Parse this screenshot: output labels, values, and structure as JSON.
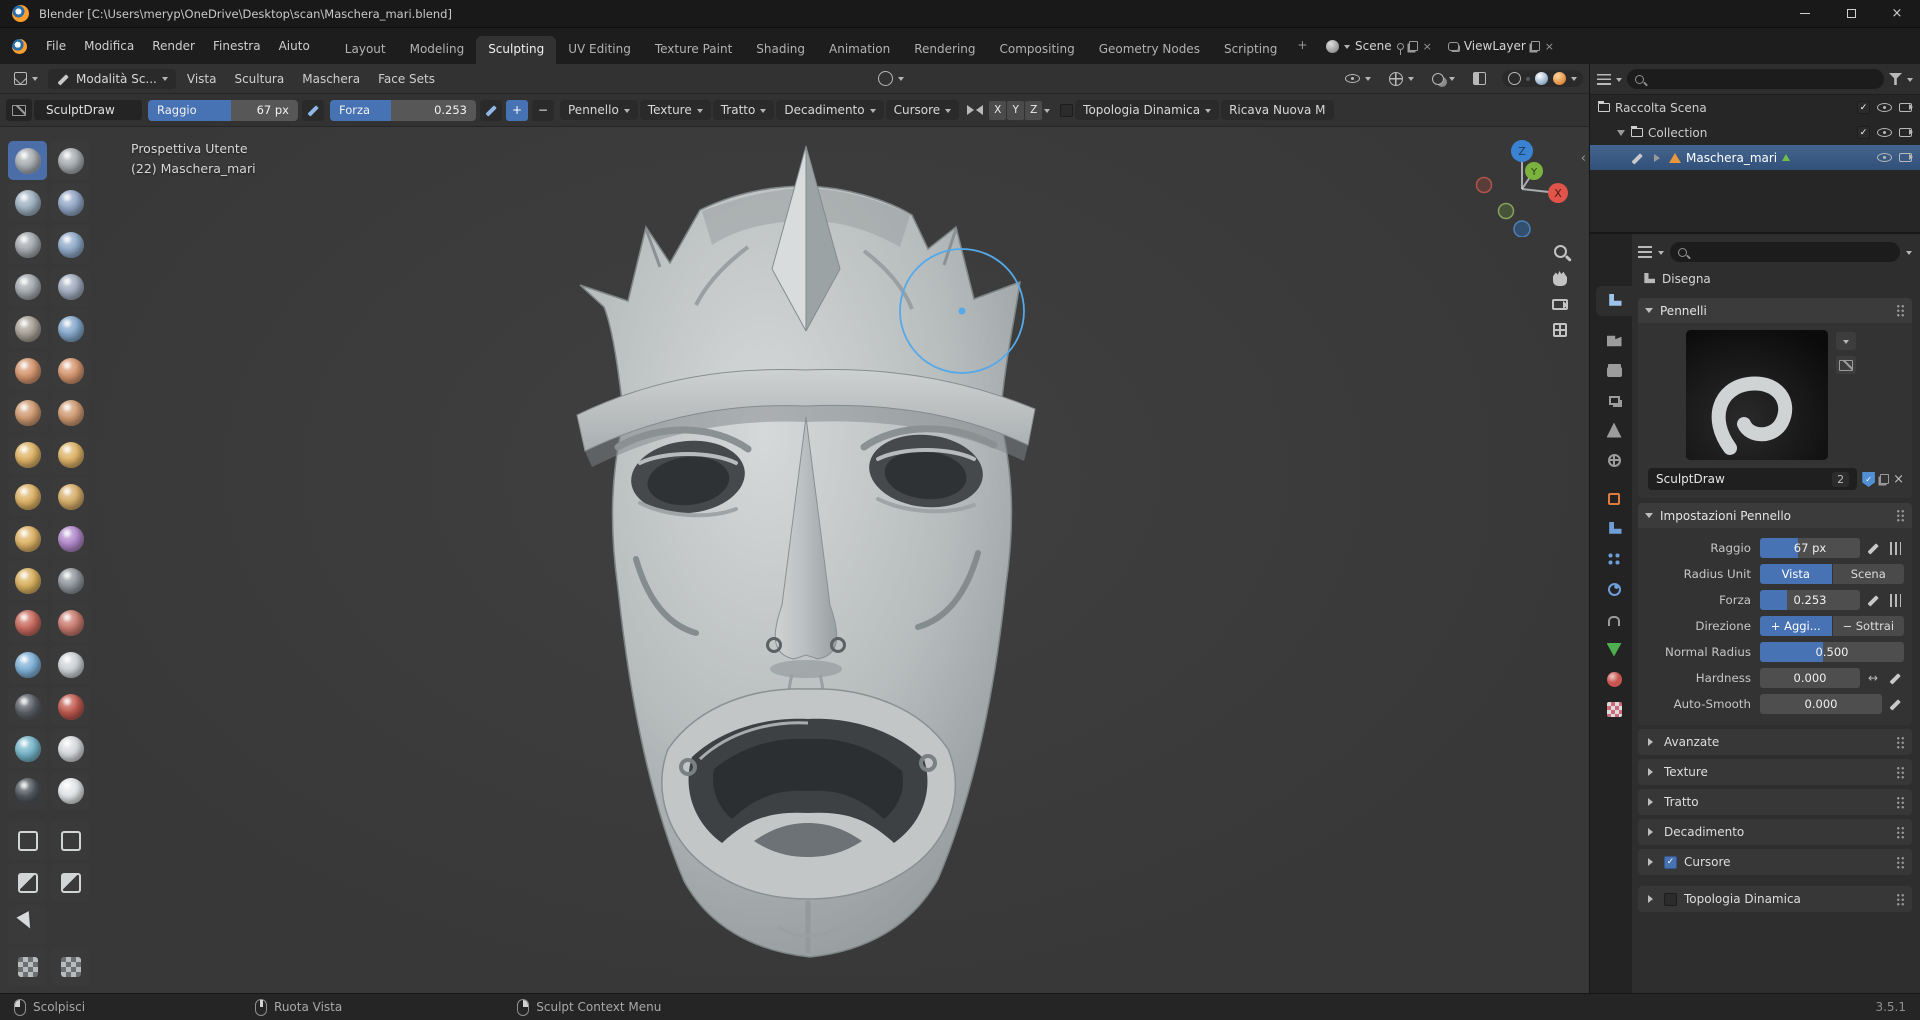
{
  "colors": {
    "accent": "#4772b3",
    "axis_x": "#e0544a",
    "axis_y": "#7cb33e",
    "axis_z": "#3a83d2",
    "cursor": "#54a9ea"
  },
  "icons": {
    "close": "×",
    "check": "✓",
    "arrows": "↔",
    "collapse": "‹"
  },
  "window": {
    "title": "Blender [C:\\Users\\meryp\\OneDrive\\Desktop\\scan\\Maschera_mari.blend]"
  },
  "menubar": {
    "menus": [
      "File",
      "Modifica",
      "Render",
      "Finestra",
      "Aiuto"
    ],
    "workspaces": [
      "Layout",
      "Modeling",
      "Sculpting",
      "UV Editing",
      "Texture Paint",
      "Shading",
      "Animation",
      "Rendering",
      "Compositing",
      "Geometry Nodes",
      "Scripting"
    ],
    "active_workspace": "Sculpting",
    "add_tab": "+",
    "scene_label": "Scene",
    "viewlayer_label": "ViewLayer"
  },
  "viewheader": {
    "mode_label": "Modalità Sc...",
    "menus": [
      "Vista",
      "Scultura",
      "Maschera",
      "Face Sets"
    ]
  },
  "brushheader": {
    "brush_label": "SculptDraw",
    "radius_label": "Raggio",
    "radius_value": "67 px",
    "radius_fill": 0.55,
    "strength_label": "Forza",
    "strength_value": "0.253",
    "strength_fill": 0.42,
    "add_label": "+",
    "subtract_label": "−",
    "dropdowns": [
      "Pennello",
      "Texture",
      "Tratto",
      "Decadimento",
      "Cursore"
    ],
    "axes": [
      "X",
      "Y",
      "Z"
    ],
    "dyntopo_label": "Topologia Dinamica",
    "remesh_label": "Ricava Nuova M"
  },
  "viewport": {
    "view_label": "Prospettiva Utente",
    "object_label": "(22) Maschera_mari",
    "gizmo": {
      "x": "X",
      "y": "Y",
      "z": "Z"
    }
  },
  "toolbar": {
    "selected": "draw",
    "brushes": [
      {
        "name": "draw",
        "color": "#a9aeb3"
      },
      {
        "name": "draw-sharp",
        "color": "#a9aeb3"
      },
      {
        "name": "clay",
        "color": "#9eb1c0"
      },
      {
        "name": "clay-strips",
        "color": "#92a7c5"
      },
      {
        "name": "clay-thumb",
        "color": "#a5aaaf"
      },
      {
        "name": "layer",
        "color": "#90aac9"
      },
      {
        "name": "inflate",
        "color": "#a5aaaf"
      },
      {
        "name": "blob",
        "color": "#a0acbe"
      },
      {
        "name": "crease",
        "color": "#a8a298"
      },
      {
        "name": "smooth",
        "color": "#85a8cc"
      },
      {
        "name": "flatten",
        "color": "#d5966f"
      },
      {
        "name": "fill",
        "color": "#d5966f"
      },
      {
        "name": "scrape",
        "color": "#d09b73"
      },
      {
        "name": "multiplane-scrape",
        "color": "#d09b73"
      },
      {
        "name": "pinch",
        "color": "#deb367"
      },
      {
        "name": "grab",
        "color": "#deb367"
      },
      {
        "name": "elastic-deform",
        "color": "#deb367"
      },
      {
        "name": "snake-hook",
        "color": "#d6ae69"
      },
      {
        "name": "thumb",
        "color": "#deb367"
      },
      {
        "name": "pose",
        "color": "#b188ca"
      },
      {
        "name": "nudge",
        "color": "#d9b15f"
      },
      {
        "name": "rotate",
        "color": "#90979d"
      },
      {
        "name": "slide-relax",
        "color": "#c96b5f"
      },
      {
        "name": "boundary",
        "color": "#c97b6f"
      },
      {
        "name": "cloth",
        "color": "#80b1d7"
      },
      {
        "name": "simplify",
        "color": "#ced3d7"
      },
      {
        "name": "mask",
        "color": "#5c6167"
      },
      {
        "name": "draw-face-sets",
        "color": "#c05a50"
      },
      {
        "name": "multires-eraser",
        "color": "#77b6ca"
      },
      {
        "name": "multires-smear",
        "color": "#d8dbde"
      },
      {
        "name": "paint",
        "color": "#50575d"
      },
      {
        "name": "smear",
        "color": "#e3e6e8"
      }
    ],
    "box_tools": [
      "box-mask",
      "box-hide",
      "box-face-set",
      "box-trim"
    ],
    "extra_tools": [
      "transform-arrow",
      "mesh-filter",
      "cloth-filter"
    ]
  },
  "outliner": {
    "rows": [
      {
        "label": "Raccolta Scena",
        "level": 0,
        "icon": "collection",
        "disclosure": "none",
        "right": [
          "checkbox",
          "eye",
          "camera"
        ],
        "selected": false
      },
      {
        "label": "Collection",
        "level": 1,
        "icon": "collection",
        "disclosure": "open",
        "right": [
          "checkbox",
          "eye",
          "camera"
        ],
        "selected": false
      },
      {
        "label": "Maschera_mari",
        "level": 2,
        "icon": "mesh",
        "badge": true,
        "disclosure": "closed",
        "right": [
          "eye",
          "camera"
        ],
        "selected": true,
        "edit_icon": true
      }
    ]
  },
  "properties": {
    "context_label": "Disegna",
    "tabs": [
      {
        "name": "tool",
        "shape": "wrench",
        "color": "#9ec3ea",
        "active": true
      },
      {
        "name": "render",
        "shape": "camera",
        "color": "#9c9c9c"
      },
      {
        "name": "output",
        "shape": "printer",
        "color": "#9c9c9c"
      },
      {
        "name": "view-layer",
        "shape": "layers",
        "color": "#9c9c9c"
      },
      {
        "name": "scene",
        "shape": "scene",
        "color": "#9c9c9c"
      },
      {
        "name": "world",
        "shape": "globe",
        "color": "#9c9c9c"
      },
      {
        "name": "object",
        "shape": "outline",
        "color": "#e07c3e"
      },
      {
        "name": "modifiers",
        "shape": "wrench",
        "color": "#6f9fd8"
      },
      {
        "name": "particles",
        "shape": "dots",
        "color": "#6f9fd8"
      },
      {
        "name": "physics",
        "shape": "orbit",
        "color": "#6f9fd8"
      },
      {
        "name": "constraints",
        "shape": "clamp",
        "color": "#9c9c9c"
      },
      {
        "name": "object-data",
        "shape": "tri",
        "color": "#4fae4f"
      },
      {
        "name": "material",
        "shape": "sphere",
        "color": "#c8544f"
      },
      {
        "name": "texture",
        "shape": "checker",
        "color": "#cf6a7a"
      }
    ],
    "pennelli": {
      "title": "Pennelli",
      "brush_name": "SculptDraw",
      "users": "2"
    },
    "settings": {
      "title": "Impostazioni Pennello",
      "rows": [
        {
          "label": "Raggio",
          "type": "slider",
          "value": "67 px",
          "fill": 0.38,
          "icons": [
            "pen",
            "bars"
          ]
        },
        {
          "label": "Radius Unit",
          "type": "segmented",
          "options": [
            "Vista",
            "Scena"
          ],
          "active": 0
        },
        {
          "label": "Forza",
          "type": "slider",
          "value": "0.253",
          "fill": 0.27,
          "icons": [
            "pen",
            "bars"
          ]
        },
        {
          "label": "Direzione",
          "type": "segmented",
          "options": [
            "+ Aggi...",
            "− Sottrai"
          ],
          "active": 0
        },
        {
          "label": "Normal Radius",
          "type": "slider",
          "value": "0.500",
          "fill": 0.44,
          "icons": []
        },
        {
          "label": "Hardness",
          "type": "slider",
          "value": "0.000",
          "fill": 0,
          "icons": [
            "arrows",
            "pen"
          ]
        },
        {
          "label": "Auto-Smooth",
          "type": "slider",
          "value": "0.000",
          "fill": 0,
          "icons": [
            "pen"
          ]
        }
      ]
    },
    "collapsed_panels": [
      {
        "label": "Avanzate"
      },
      {
        "label": "Texture"
      },
      {
        "label": "Tratto"
      },
      {
        "label": "Decadimento"
      },
      {
        "label": "Cursore",
        "checkbox": true,
        "checked": true
      },
      {
        "label": "Topologia Dinamica",
        "checkbox": true,
        "checked": false,
        "separate": true
      }
    ]
  },
  "statusbar": {
    "items": [
      {
        "icon": "mouse-left",
        "label": "Scolpisci"
      },
      {
        "icon": "mouse-middle",
        "label": "Ruota Vista"
      },
      {
        "icon": "mouse-right",
        "label": "Sculpt Context Menu"
      }
    ],
    "version": "3.5.1"
  }
}
